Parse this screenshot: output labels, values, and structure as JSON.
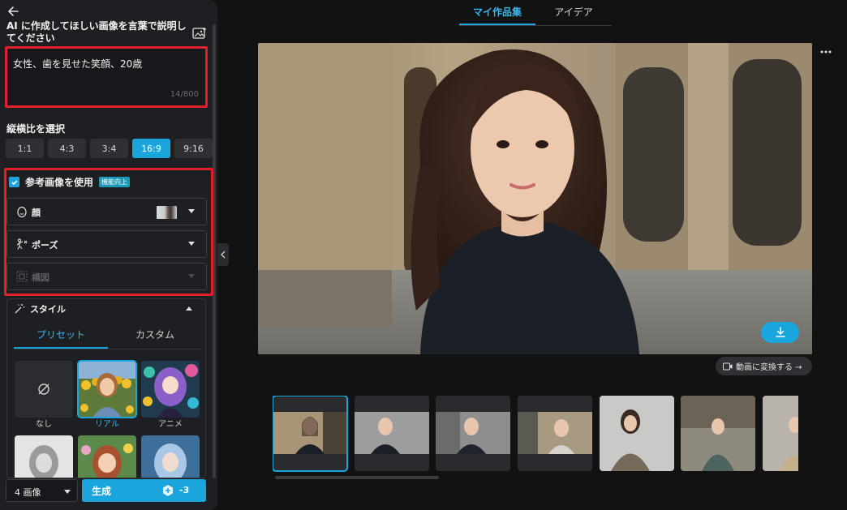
{
  "panel": {
    "prompt_title": "AI に作成してほしい画像を言葉で説明してください",
    "prompt_value": "女性、歯を見せた笑顔、20歳",
    "prompt_count": "14/800",
    "ratio_label": "縦横比を選択",
    "ratios": [
      "1:1",
      "4:3",
      "3:4",
      "16:9",
      "9:16"
    ],
    "ratio_selected": "16:9",
    "reference": {
      "label": "参考画像を使用",
      "badge": "機能向上",
      "rows": [
        {
          "label": "顔",
          "icon": "face-icon"
        },
        {
          "label": "ポーズ",
          "icon": "pose-icon"
        },
        {
          "label": "構図",
          "icon": "composition-icon"
        }
      ]
    },
    "style": {
      "label": "スタイル",
      "tabs": [
        "プリセット",
        "カスタム"
      ],
      "items": [
        {
          "name": "なし"
        },
        {
          "name": "リアル"
        },
        {
          "name": "アニメ"
        },
        {
          "name": ""
        },
        {
          "name": ""
        },
        {
          "name": ""
        }
      ]
    },
    "footer": {
      "count": "4 画像",
      "generate": "生成",
      "cost": "-3"
    }
  },
  "main": {
    "tabs": [
      "マイ作品集",
      "アイデア"
    ],
    "convert": "動画に変換する →"
  },
  "colors": {
    "accent": "#1ba5dd",
    "highlight": "#e0202a"
  }
}
